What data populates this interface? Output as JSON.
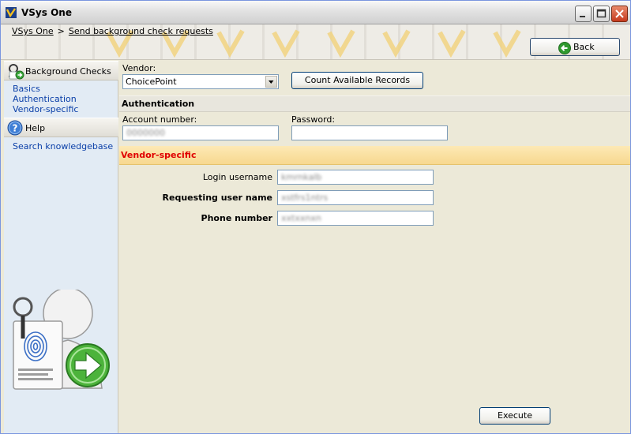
{
  "window": {
    "title": "VSys One"
  },
  "breadcrumb": {
    "root": "VSys One",
    "separator": ">",
    "current": "Send background check requests"
  },
  "toolbar": {
    "back_label": "Back"
  },
  "sidebar": {
    "background_checks": {
      "title": "Background Checks",
      "items": [
        {
          "label": "Basics"
        },
        {
          "label": "Authentication"
        },
        {
          "label": "Vendor-specific"
        }
      ]
    },
    "help": {
      "title": "Help",
      "items": [
        {
          "label": "Search knowledgebase"
        }
      ]
    }
  },
  "main": {
    "vendor_label": "Vendor:",
    "vendor_value": "ChoicePoint",
    "count_button": "Count Available Records",
    "authentication": {
      "title": "Authentication",
      "account_label": "Account number:",
      "account_value": "0000000",
      "password_label": "Password:",
      "password_value": ""
    },
    "vendor_specific": {
      "title": "Vendor-specific",
      "login_label": "Login username",
      "login_value": "kmrnkalb",
      "requesting_label": "Requesting user name",
      "requesting_value": "xstfrs1ntrs",
      "phone_label": "Phone number",
      "phone_value": "xxtxxnxn"
    },
    "execute_button": "Execute"
  },
  "colors": {
    "vendor_section_bg": "#f7d88f",
    "vendor_section_text": "#e00000",
    "sidebar_bg": "#e2ebf4",
    "link": "#0a3fa8"
  }
}
